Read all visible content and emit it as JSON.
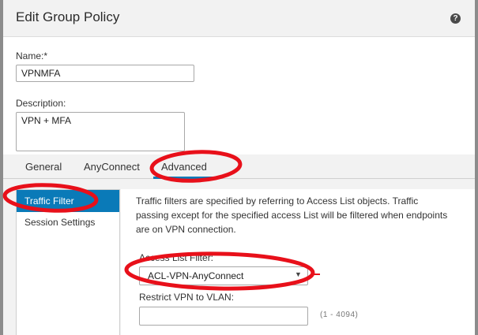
{
  "dialog": {
    "title": "Edit Group Policy",
    "help_icon": "?"
  },
  "form": {
    "name_label": "Name:*",
    "name_value": "VPNMFA",
    "description_label": "Description:",
    "description_value": "VPN + MFA"
  },
  "tabs": [
    {
      "label": "General"
    },
    {
      "label": "AnyConnect"
    },
    {
      "label": "Advanced",
      "selected": true
    }
  ],
  "sidebar": {
    "items": [
      {
        "label": "Traffic Filter",
        "selected": true
      },
      {
        "label": "Session Settings"
      }
    ]
  },
  "traffic_filter": {
    "description": "Traffic filters are specified by referring to Access List objects. Traffic passing except for the specified access List will be filtered when endpoints are on VPN connection.",
    "acl_label": "Access List Filter:",
    "acl_value": "ACL-VPN-AnyConnect",
    "vlan_label": "Restrict VPN to VLAN:",
    "vlan_value": "",
    "vlan_hint": "(1 - 4094)"
  },
  "colors": {
    "accent": "#0a7ab8",
    "annotation": "#e8101a",
    "header_bg": "#f2f2f2"
  }
}
